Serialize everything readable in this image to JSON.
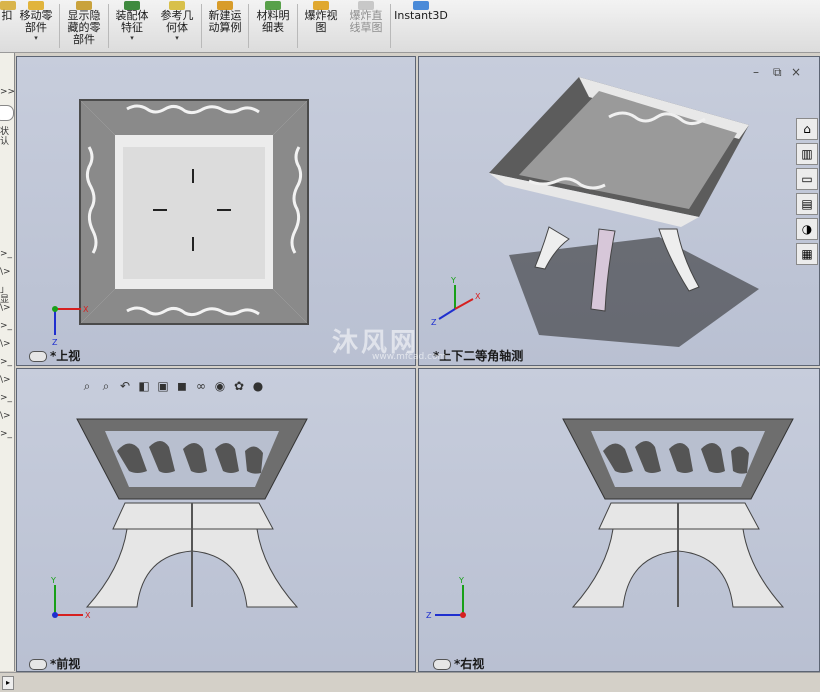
{
  "toolbar": {
    "items": [
      {
        "label": "扣",
        "icon": "assembly-icon"
      },
      {
        "label": "移动零\n部件",
        "icon": "move-component-icon",
        "dropdown": "▾"
      },
      {
        "label": "显示隐\n藏的零\n部件",
        "icon": "show-hidden-icon"
      },
      {
        "label": "装配体\n特征",
        "icon": "assembly-feature-icon",
        "dropdown": "▾"
      },
      {
        "label": "参考几\n何体",
        "icon": "reference-geometry-icon",
        "dropdown": "▾"
      },
      {
        "label": "新建运\n动算例",
        "icon": "motion-study-icon"
      },
      {
        "label": "材料明\n细表",
        "icon": "bom-icon"
      },
      {
        "label": "爆炸视\n图",
        "icon": "exploded-view-icon"
      },
      {
        "label": "爆炸直\n线草图",
        "icon": "explode-line-sketch-icon",
        "disabled": true
      },
      {
        "label": "Instant3D",
        "icon": "instant3d-icon"
      }
    ]
  },
  "left_panel": {
    "rows": [
      ">>",
      "状认",
      ">_",
      "\\>",
      "」显",
      "\\>",
      ">_",
      "\\>",
      ">_",
      "\\>",
      ">_",
      "\\>",
      ">_",
      "\\>",
      ">_",
      ">_"
    ]
  },
  "viewports": {
    "top": {
      "label": "*上视"
    },
    "iso": {
      "label": "*上下二等角轴测"
    },
    "front": {
      "label": "*前视"
    },
    "right": {
      "label": "*右视"
    }
  },
  "heads_up": {
    "icons": [
      "zoom-to-fit-icon",
      "zoom-area-icon",
      "previous-view-icon",
      "section-view-icon",
      "view-orientation-icon",
      "display-style-icon",
      "hide-show-icon",
      "edit-appearance-icon",
      "apply-scene-icon",
      "view-settings-icon"
    ]
  },
  "task_pane": {
    "icons": [
      "home-icon",
      "design-library-icon",
      "file-explorer-icon",
      "view-palette-icon",
      "appearances-icon",
      "custom-properties-icon"
    ]
  },
  "window_controls": {
    "minimize": "–",
    "restore": "⧉",
    "close": "×"
  },
  "watermark": "沐风网",
  "watermark_url": "www.mfcad.com",
  "colors": {
    "viewport_bg": "#c3c9d8",
    "part_gray": "#7c7c7c",
    "part_light": "#e8e8e8",
    "axis_x": "#d62020",
    "axis_y": "#18a018",
    "axis_z": "#1f2fcf"
  }
}
